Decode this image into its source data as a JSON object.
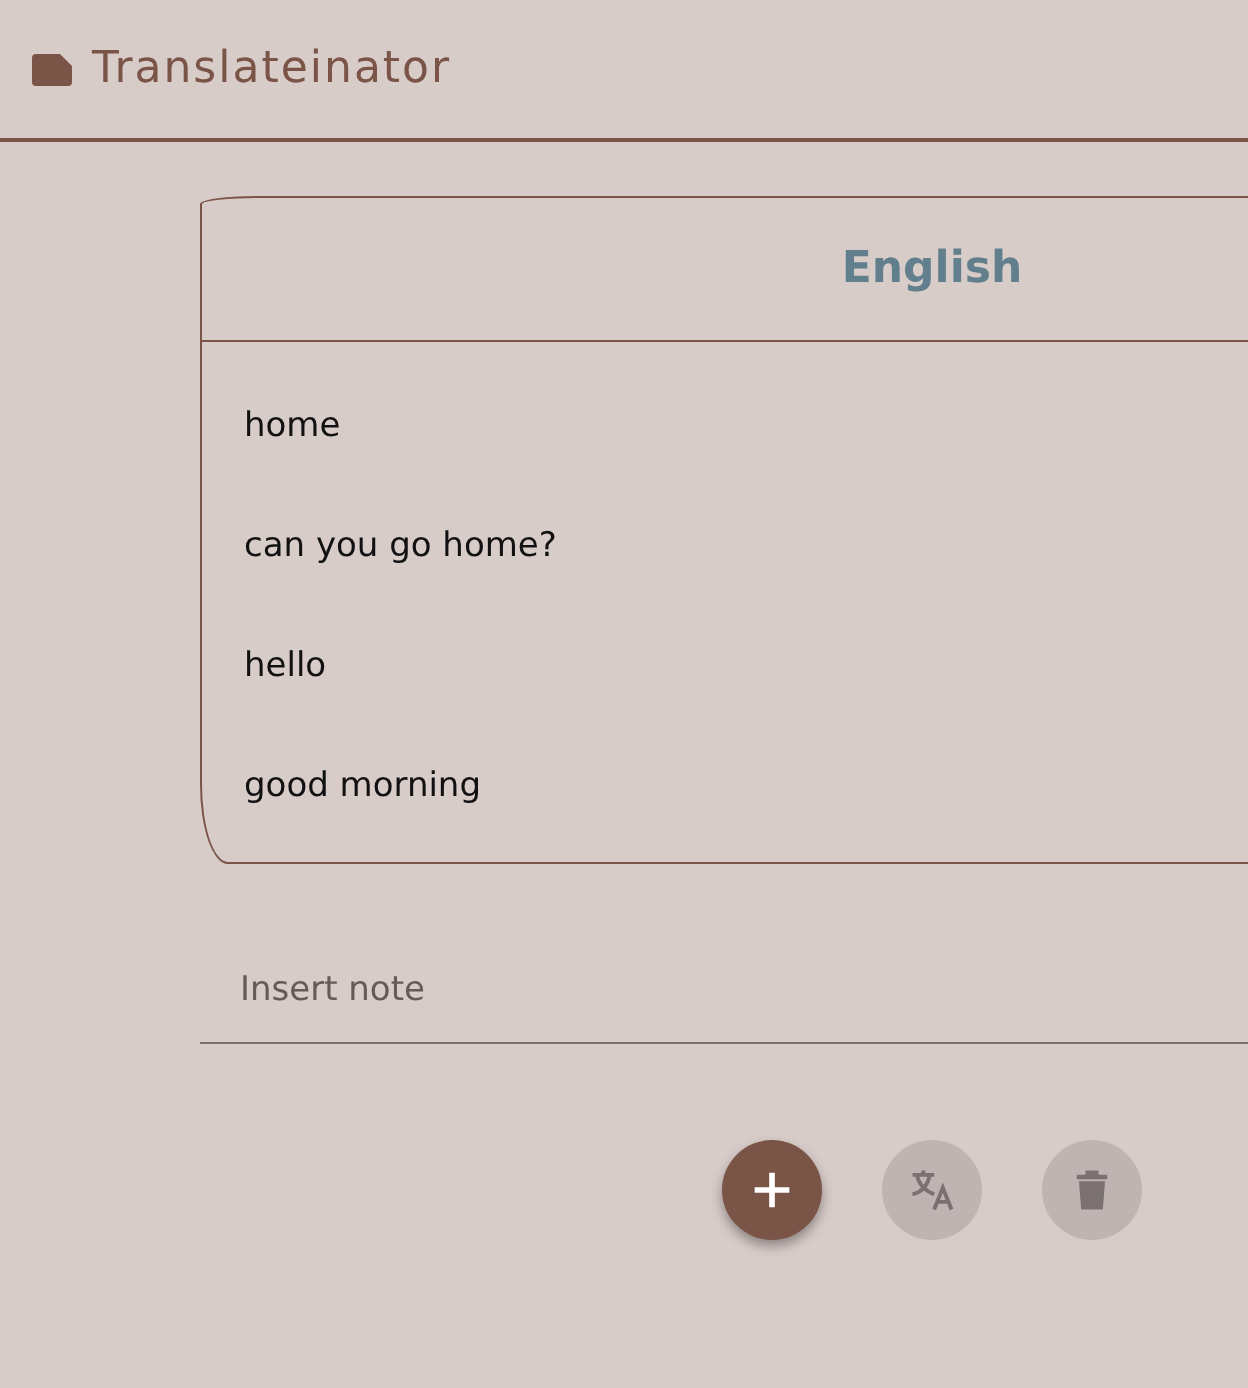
{
  "app_bar": {
    "title": "Translateinator"
  },
  "table": {
    "column_header": "English",
    "rows": [
      "home",
      "can you go home?",
      "hello",
      "good morning"
    ]
  },
  "note_field": {
    "placeholder": "Insert note"
  },
  "actions": [
    {
      "kind": "add",
      "disabled": false
    },
    {
      "kind": "translate",
      "disabled": true
    },
    {
      "kind": "delete",
      "disabled": true
    }
  ]
}
